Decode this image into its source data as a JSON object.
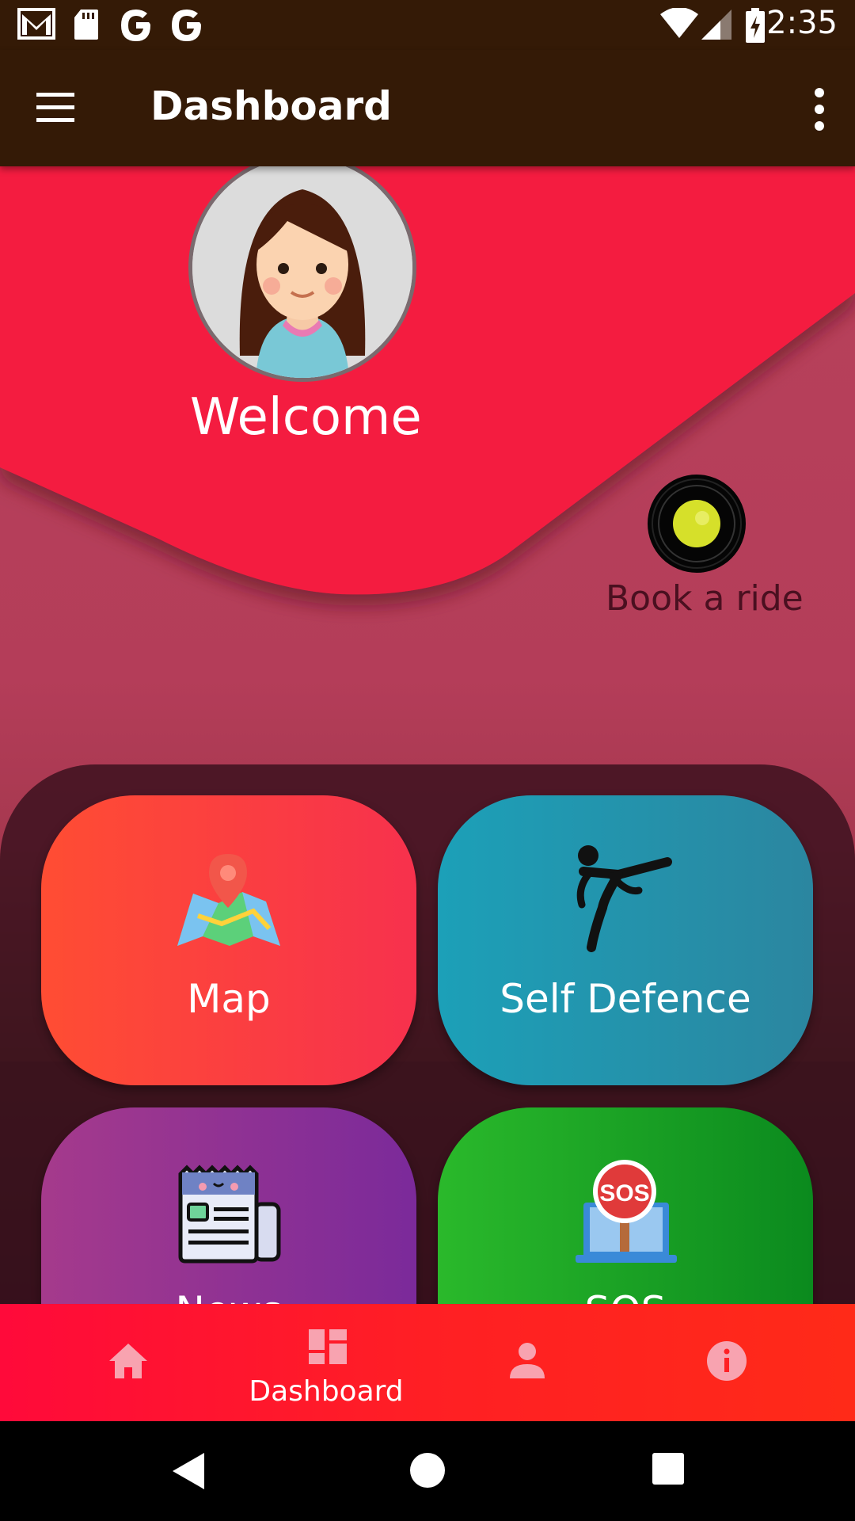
{
  "status_bar": {
    "time": "2:35",
    "left_icons": [
      "gmail-icon",
      "sd-card-icon",
      "google-icon",
      "google-icon"
    ],
    "right_icons": [
      "wifi-icon",
      "signal-icon",
      "battery-charging-icon"
    ]
  },
  "app_bar": {
    "title": "Dashboard",
    "menu_icon": "hamburger-menu-icon",
    "overflow_icon": "more-vert-icon",
    "background": "#341a06"
  },
  "header": {
    "welcome": "Welcome",
    "ride_label": "Book a ride",
    "accent": "#f41c3f"
  },
  "cards": [
    {
      "label": "Map",
      "icon": "map-pin-icon",
      "color": "#ff4d33"
    },
    {
      "label": "Self Defence",
      "icon": "karate-kick-icon",
      "color": "#1ca0b8"
    },
    {
      "label": "News",
      "icon": "newspaper-icon",
      "color": "#a53a8c"
    },
    {
      "label": "SOS",
      "icon": "sos-sign-icon",
      "color": "#2ab92b"
    }
  ],
  "bottom_nav": {
    "items": [
      {
        "icon": "home-icon",
        "label": ""
      },
      {
        "icon": "dashboard-icon",
        "label": "Dashboard"
      },
      {
        "icon": "person-icon",
        "label": ""
      },
      {
        "icon": "info-icon",
        "label": ""
      }
    ],
    "selected": 1
  },
  "system_nav": [
    "back-icon",
    "home-circle-icon",
    "recents-icon"
  ]
}
